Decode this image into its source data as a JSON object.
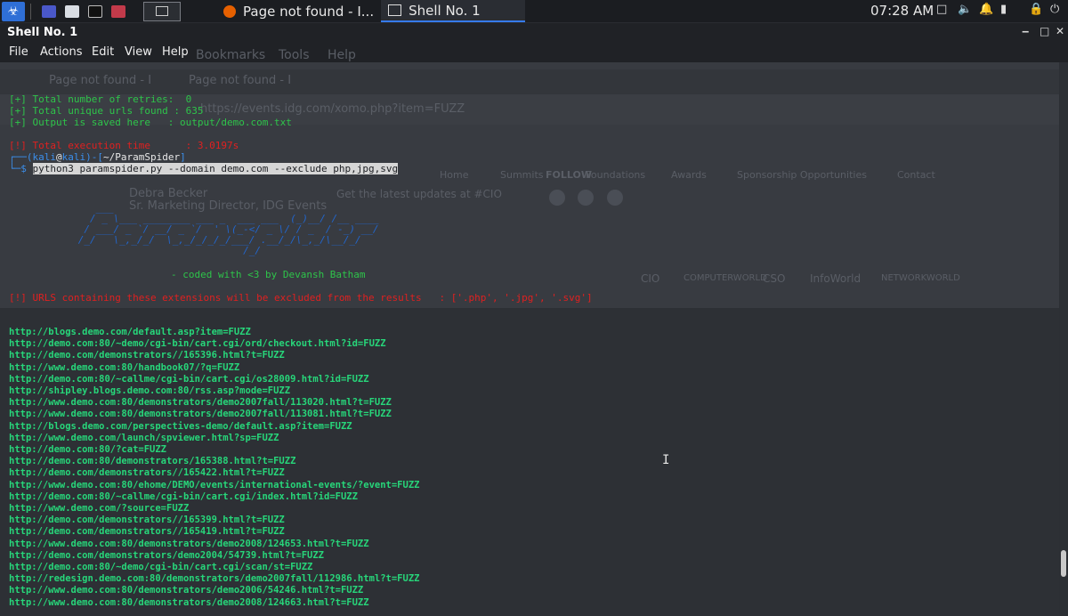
{
  "panel": {
    "tasks": [
      {
        "label": "Page not found - I..."
      },
      {
        "label": "Shell No. 1"
      }
    ],
    "clock": "07:28 AM"
  },
  "window": {
    "title": "Shell No. 1",
    "menu": [
      "File",
      "Actions",
      "Edit",
      "View",
      "Help"
    ]
  },
  "ghost": {
    "tab1": "Page not found - I",
    "tab2": "Page not found - I",
    "menu": [
      "Bookmarks",
      "Tools",
      "Help"
    ],
    "url": "https://events.idg.com/xomo.php?item=FUZZ",
    "nav": [
      "Home",
      "Summits",
      "Foundations",
      "Awards",
      "Sponsorship Opportunities",
      "Contact"
    ],
    "follow": "FOLLOW",
    "updates": "Get the latest updates at #CIO",
    "person_name": "Debra Becker",
    "person_title": "Sr. Marketing Director, IDG Events",
    "brands": [
      "CIO",
      "COMPUTERWORLD",
      "CSO",
      "InfoWorld",
      "NETWORKWORLD"
    ]
  },
  "terminal": {
    "retries": "[+] Total number of retries:  0",
    "unique": "[+] Total unique urls found : 635",
    "output": "[+] Output is saved here   : output/demo.com.txt",
    "exec_time": "[!] Total execution time      : 3.0197s",
    "prompt_user": "kali",
    "prompt_at": "@",
    "prompt_host": "kali",
    "prompt_dir": "~/ParamSpider",
    "command": "python3 paramspider.py --domain demo.com --exclude php,jpg,svg",
    "ascii_art": "         ___\n        / _ \\___ ________ ___ _  ___ ___  (_)__/ /__ ____\n       / ___/ _ `/ __/ _ `/  ' \\(_-</ _ \\/ / _  / -_) __/\n      /_/   \\_,_/_/  \\_,_/_/_/_/___/ .__/_/\\_,_/\\__/_/\n                                  /_/",
    "credit": "- coded with <3 by Devansh Batham",
    "exclude_msg": "[!] URLS containing these extensions will be excluded from the results   : ['.php', '.jpg', '.svg']",
    "urls": [
      "http://blogs.demo.com/default.asp?item=FUZZ",
      "http://demo.com:80/~demo/cgi-bin/cart.cgi/ord/checkout.html?id=FUZZ",
      "http://demo.com/demonstrators//165396.html?t=FUZZ",
      "http://www.demo.com:80/handbook07/?q=FUZZ",
      "http://demo.com:80/~callme/cgi-bin/cart.cgi/os28009.html?id=FUZZ",
      "http://shipley.blogs.demo.com:80/rss.asp?mode=FUZZ",
      "http://www.demo.com:80/demonstrators/demo2007fall/113020.html?t=FUZZ",
      "http://www.demo.com:80/demonstrators/demo2007fall/113081.html?t=FUZZ",
      "http://blogs.demo.com/perspectives-demo/default.asp?item=FUZZ",
      "http://www.demo.com/launch/spviewer.html?sp=FUZZ",
      "http://demo.com:80/?cat=FUZZ",
      "http://demo.com:80/demonstrators/165388.html?t=FUZZ",
      "http://demo.com/demonstrators//165422.html?t=FUZZ",
      "http://www.demo.com:80/ehome/DEMO/events/international-events/?event=FUZZ",
      "http://demo.com:80/~callme/cgi-bin/cart.cgi/index.html?id=FUZZ",
      "http://www.demo.com/?source=FUZZ",
      "http://demo.com/demonstrators//165399.html?t=FUZZ",
      "http://demo.com/demonstrators//165419.html?t=FUZZ",
      "http://www.demo.com:80/demonstrators/demo2008/124653.html?t=FUZZ",
      "http://demo.com/demonstrators/demo2004/54739.html?t=FUZZ",
      "http://demo.com:80/~demo/cgi-bin/cart.cgi/scan/st=FUZZ",
      "http://redesign.demo.com:80/demonstrators/demo2007fall/112986.html?t=FUZZ",
      "http://www.demo.com:80/demonstrators/demo2006/54246.html?t=FUZZ",
      "http://www.demo.com:80/demonstrators/demo2008/124663.html?t=FUZZ"
    ]
  },
  "colors": {
    "accent": "#367bf0",
    "green": "#2ec44a",
    "red": "#e02020",
    "url_green": "#27d67a"
  }
}
